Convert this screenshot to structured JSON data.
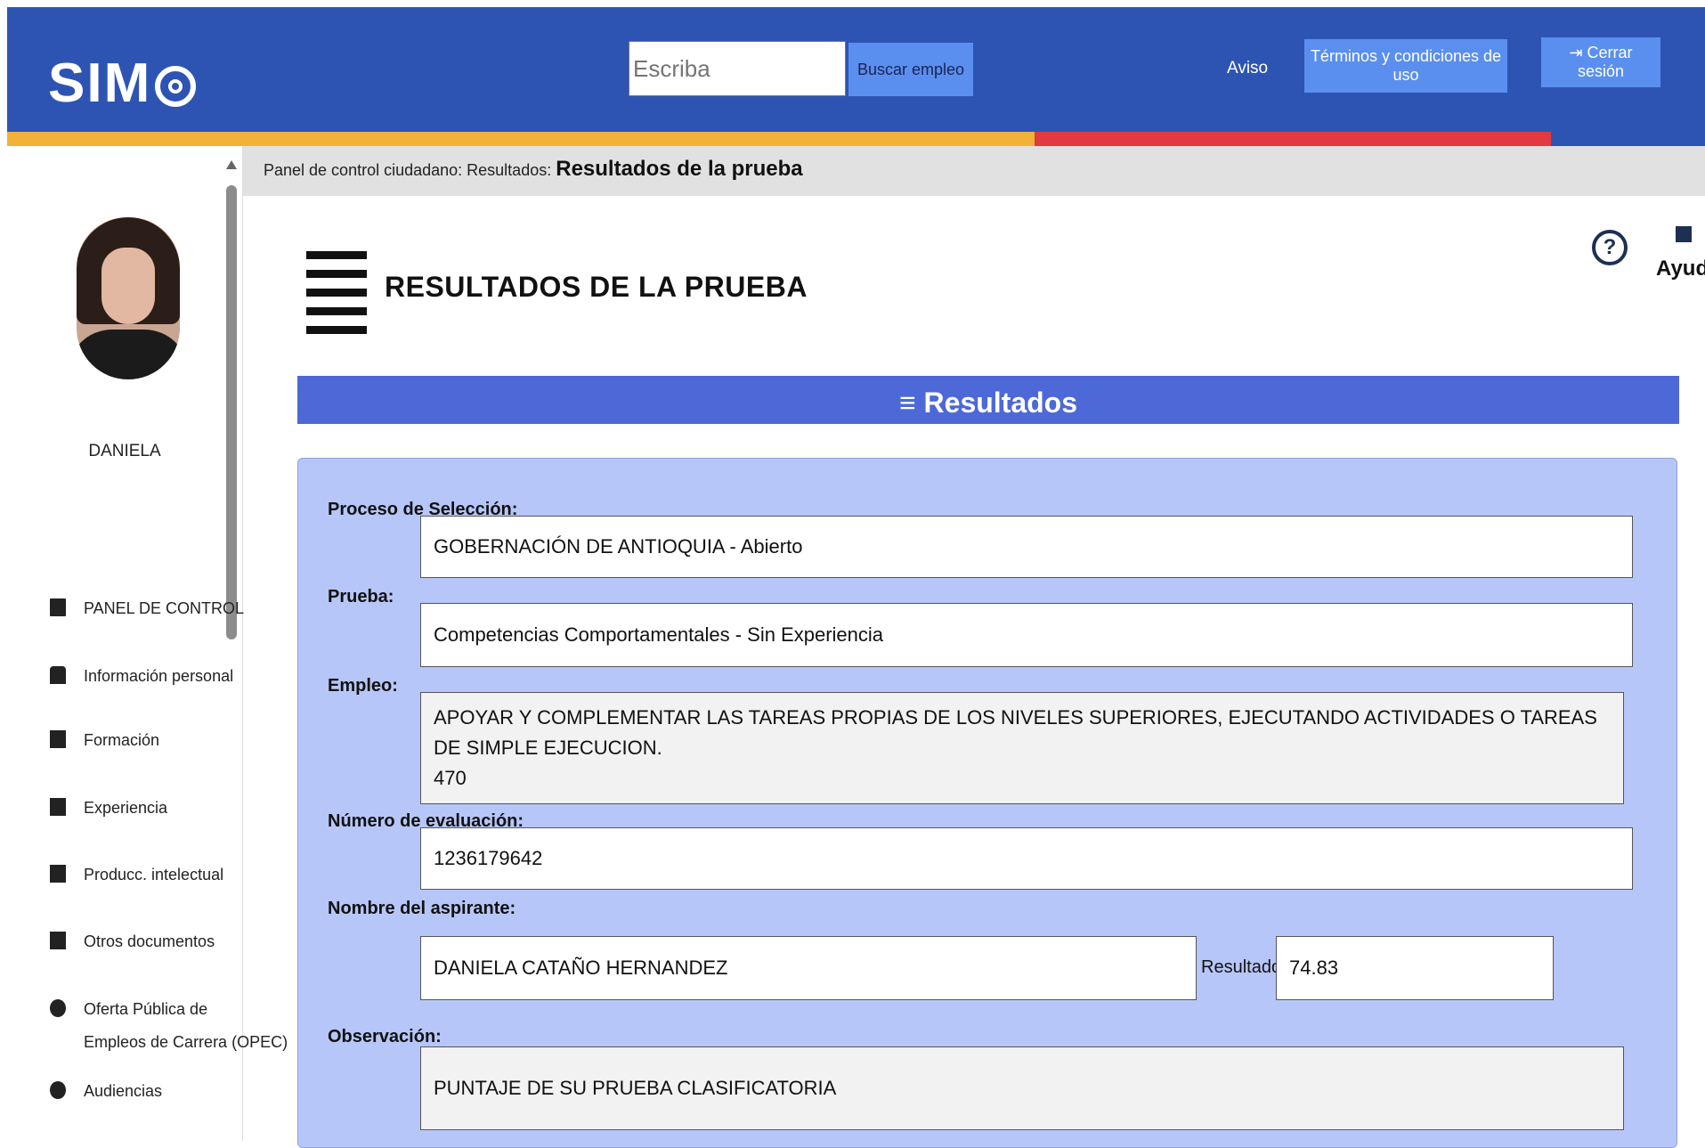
{
  "header": {
    "logo_text": "SIMO",
    "search_placeholder": "Escriba",
    "search_button": "Buscar empleo",
    "aviso_link": "Aviso",
    "terms_button": "Términos y condiciones de uso",
    "logout_button": "Cerrar sesión"
  },
  "sidebar": {
    "user_name": "DANIELA",
    "items": [
      {
        "label": "PANEL DE CONTROL",
        "icon": "dashboard-icon"
      },
      {
        "label": "Información personal",
        "icon": "people-icon"
      },
      {
        "label": "Formación",
        "icon": "education-icon"
      },
      {
        "label": "Experiencia",
        "icon": "briefcase-icon"
      },
      {
        "label": "Producc. intelectual",
        "icon": "book-icon"
      },
      {
        "label": "Otros documentos",
        "icon": "document-icon"
      },
      {
        "label": "Oferta Pública de",
        "label2": "Empleos de Carrera (OPEC)",
        "icon": "globe-icon"
      },
      {
        "label": "Audiencias",
        "icon": "audience-icon"
      }
    ]
  },
  "breadcrumb": {
    "prefix": "Panel de control ciudadano: Resultados:",
    "current": "Resultados de la prueba"
  },
  "page": {
    "title": "RESULTADOS DE LA PRUEBA",
    "help_label": "Ayudas"
  },
  "results": {
    "panel_title": "≡ Resultados",
    "proceso_label": "Proceso de Selección:",
    "proceso_value": "GOBERNACIÓN DE ANTIOQUIA - Abierto",
    "prueba_label": "Prueba:",
    "prueba_value": "Competencias Comportamentales - Sin Experiencia",
    "empleo_label": "Empleo:",
    "empleo_value_line1": "APOYAR Y COMPLEMENTAR LAS TAREAS PROPIAS DE LOS NIVELES SUPERIORES, EJECUTANDO ACTIVIDADES O TAREAS DE SIMPLE EJECUCION.",
    "empleo_value_line2": "470",
    "numero_label": "Número de evaluación:",
    "numero_value": "1236179642",
    "nombre_label": "Nombre del aspirante:",
    "nombre_value": "DANIELA CATAÑO HERNANDEZ",
    "resultado_label": "Resultado:",
    "resultado_value": "74.83",
    "observacion_label": "Observación:",
    "observacion_value": "PUNTAJE DE SU PRUEBA CLASIFICATORIA"
  }
}
